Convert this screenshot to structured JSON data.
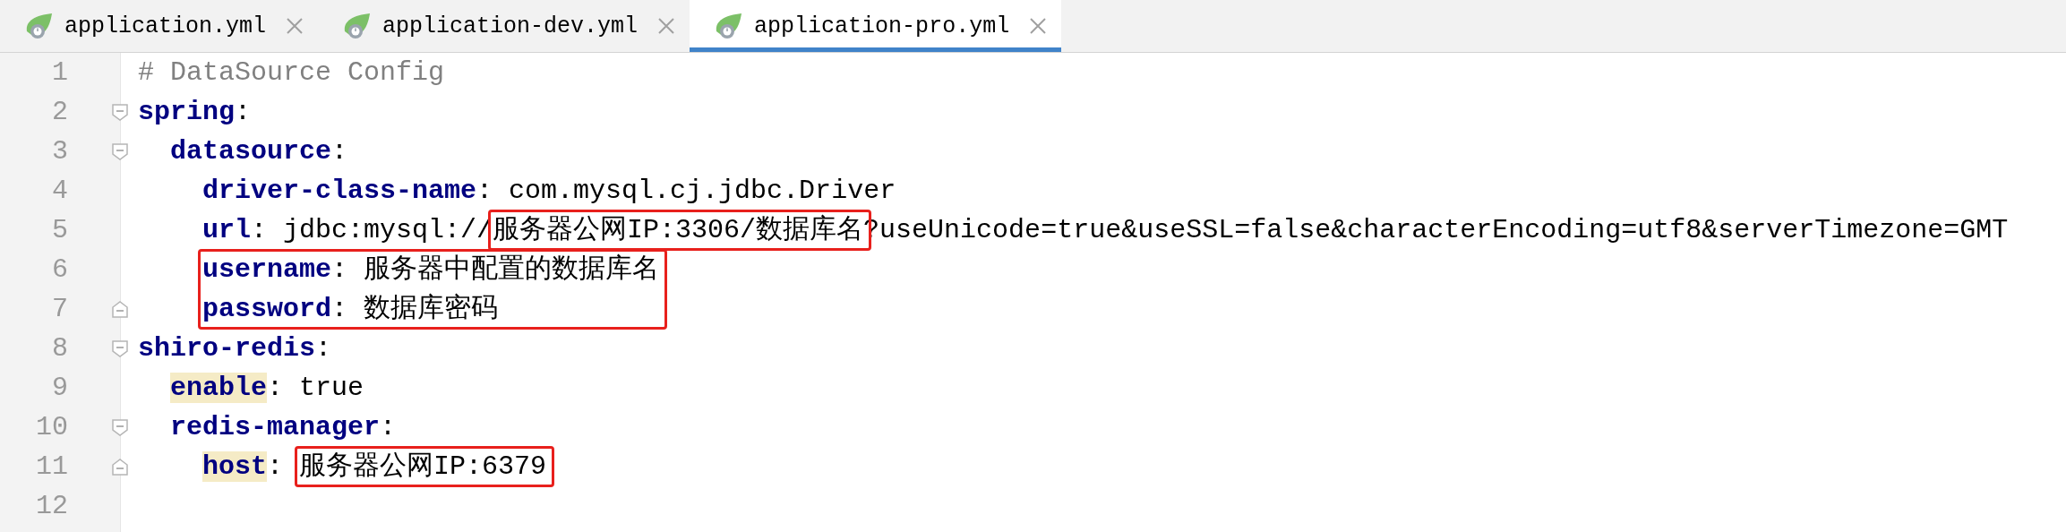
{
  "tabs": [
    {
      "label": "application.yml",
      "selected": false
    },
    {
      "label": "application-dev.yml",
      "selected": false
    },
    {
      "label": "application-pro.yml",
      "selected": true
    }
  ],
  "editor": {
    "lines": [
      {
        "number": "1",
        "kind": "comment",
        "text": "# DataSource Config"
      },
      {
        "number": "2",
        "kind": "entry",
        "key": "spring",
        "highlighted": false,
        "boxed": false,
        "segments": [
          {
            "text": ":",
            "boxed": false
          }
        ],
        "children": [
          {
            "number": "3",
            "kind": "entry",
            "key": "datasource",
            "highlighted": false,
            "boxed": false,
            "segments": [
              {
                "text": ":",
                "boxed": false
              }
            ],
            "children": [
              {
                "number": "4",
                "kind": "entry",
                "key": "driver-class-name",
                "highlighted": false,
                "boxed": false,
                "segments": [
                  {
                    "text": ": com.mysql.cj.jdbc.Driver",
                    "boxed": false
                  }
                ]
              },
              {
                "number": "5",
                "kind": "entry",
                "key": "url",
                "highlighted": false,
                "boxed": false,
                "segments": [
                  {
                    "text": ": jdbc:mysql://",
                    "boxed": false
                  },
                  {
                    "text": "服务器公网IP:3306/数据库名",
                    "boxed": true
                  },
                  {
                    "text": "?useUnicode=true&useSSL=false&characterEncoding=utf8&serverTimezone=GMT",
                    "boxed": false
                  }
                ]
              },
              {
                "number": "6",
                "kind": "entry",
                "key": "username",
                "highlighted": false,
                "boxed": true,
                "segments": [
                  {
                    "text": ": 服务器中配置的数据库名",
                    "boxed": false
                  }
                ]
              },
              {
                "number": "7",
                "kind": "entry",
                "key": "password",
                "highlighted": false,
                "boxed": true,
                "segments": [
                  {
                    "text": ": 数据库密码",
                    "boxed": false
                  }
                ]
              }
            ]
          }
        ]
      },
      {
        "number": "8",
        "kind": "entry",
        "key": "shiro-redis",
        "highlighted": false,
        "boxed": false,
        "segments": [
          {
            "text": ":",
            "boxed": false
          }
        ],
        "children": [
          {
            "number": "9",
            "kind": "entry",
            "key": "enable",
            "highlighted": true,
            "boxed": false,
            "segments": [
              {
                "text": ": true",
                "boxed": false
              }
            ]
          },
          {
            "number": "10",
            "kind": "entry",
            "key": "redis-manager",
            "highlighted": false,
            "boxed": false,
            "segments": [
              {
                "text": ":",
                "boxed": false
              }
            ],
            "children": [
              {
                "number": "11",
                "kind": "entry",
                "key": "host",
                "highlighted": true,
                "boxed": false,
                "segments": [
                  {
                    "text": ": ",
                    "boxed": false
                  },
                  {
                    "text": "服务器公网IP:6379",
                    "boxed": true
                  }
                ]
              }
            ]
          }
        ]
      },
      {
        "number": "12",
        "kind": "blank"
      }
    ]
  }
}
